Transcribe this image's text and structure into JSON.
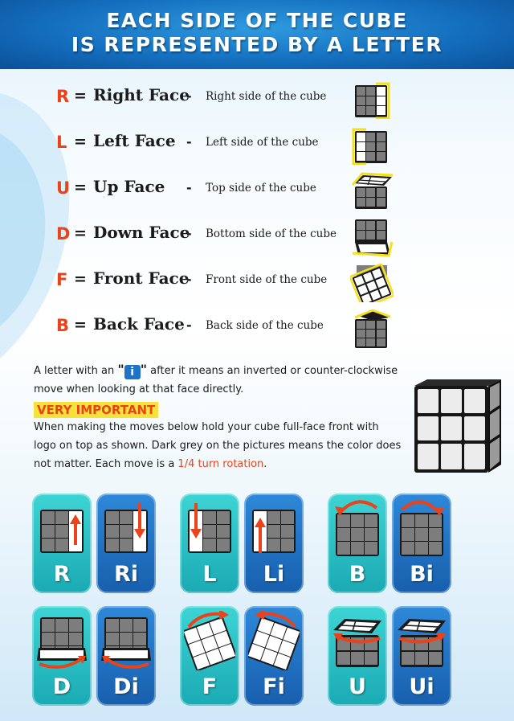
{
  "header": {
    "line1": "EACH SIDE OF THE CUBE",
    "line2": "IS REPRESENTED BY A LETTER"
  },
  "faces": [
    {
      "letter": "R",
      "eq": "=",
      "name": "Right Face",
      "dash": "-",
      "desc": "Right side of the cube"
    },
    {
      "letter": "L",
      "eq": "=",
      "name": "Left Face",
      "dash": "-",
      "desc": "Left side of the cube"
    },
    {
      "letter": "U",
      "eq": "=",
      "name": "Up Face",
      "dash": "-",
      "desc": "Top side of the cube"
    },
    {
      "letter": "D",
      "eq": "=",
      "name": "Down Face",
      "dash": "-",
      "desc": "Bottom side of the cube"
    },
    {
      "letter": "F",
      "eq": "=",
      "name": "Front Face",
      "dash": "-",
      "desc": "Front side of the cube"
    },
    {
      "letter": "B",
      "eq": "=",
      "name": "Back Face",
      "dash": "-",
      "desc": "Back side of the cube"
    }
  ],
  "inverted_note": {
    "part1": "A letter with an ",
    "quote_open": "\"",
    "badge": "i",
    "quote_close": "\"",
    "part2": " after it means an inverted or counter-clockwise move when looking at that face directly."
  },
  "important": {
    "label": "VERY IMPORTANT",
    "text": "When making the moves below hold your cube full-face front with logo on top as shown. Dark grey on the pictures means the color does not matter. Each move is a ",
    "highlight": "1/4 turn rotation",
    "end": "."
  },
  "moves": [
    {
      "label": "R"
    },
    {
      "label": "Ri"
    },
    {
      "label": "L"
    },
    {
      "label": "Li"
    },
    {
      "label": "B"
    },
    {
      "label": "Bi"
    },
    {
      "label": "D"
    },
    {
      "label": "Di"
    },
    {
      "label": "F"
    },
    {
      "label": "Fi"
    },
    {
      "label": "U"
    },
    {
      "label": "Ui"
    }
  ],
  "colors": {
    "accent": "#e8431a",
    "teal_card": "#1aaab4",
    "blue_card": "#1e73c8",
    "highlight_yellow": "#f6e23a",
    "cube_grey": "#7a7a7a"
  }
}
